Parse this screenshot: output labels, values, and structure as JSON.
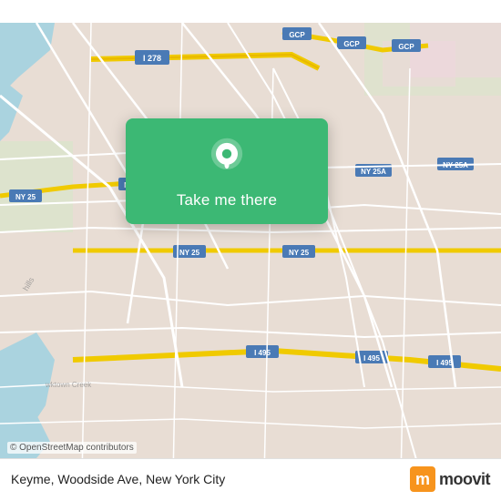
{
  "map": {
    "attribution": "© OpenStreetMap contributors",
    "background_color": "#e8ddd4"
  },
  "action_card": {
    "button_label": "Take me there",
    "pin_alt": "location pin"
  },
  "location": {
    "name": "Keyme, Woodside Ave, New York City"
  },
  "brand": {
    "name": "moovit",
    "logo_letter": "m"
  }
}
